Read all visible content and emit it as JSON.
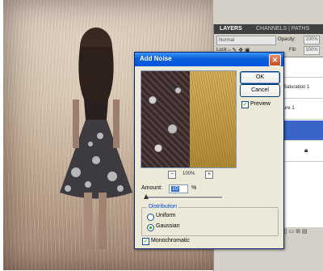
{
  "layers_panel": {
    "tab_label": "LAYERS",
    "tabs_more": "CHANNELS | PATHS",
    "blend_mode": "Normal",
    "opacity_label": "Opacity:",
    "opacity_value": "100%",
    "lock_label": "Lock:",
    "fill_label": "Fill:",
    "fill_value": "100%",
    "layer_rows": [
      {
        "label": ""
      },
      {
        "label": "Saturation 1"
      },
      {
        "label": "ure 1"
      },
      {
        "label": ""
      },
      {
        "label": ""
      }
    ]
  },
  "dialog": {
    "title": "Add Noise",
    "ok_label": "OK",
    "cancel_label": "Cancel",
    "preview_label": "Preview",
    "preview_checked": true,
    "zoom_out_label": "−",
    "zoom_level": "100%",
    "zoom_in_label": "+",
    "amount_label": "Amount:",
    "amount_value": "10",
    "amount_unit": "%",
    "amount_fraction": 0.025,
    "distribution_label": "Distribution",
    "uniform_label": "Uniform",
    "gaussian_label": "Gaussian",
    "selected_distribution": "Gaussian",
    "monochromatic_label": "Monochromatic",
    "monochromatic_checked": true,
    "close_glyph": "✕"
  },
  "colors": {
    "titlebar": "#0054e3",
    "selected_layer": "#3a64c8",
    "dialog_bg": "#ece9d8"
  }
}
